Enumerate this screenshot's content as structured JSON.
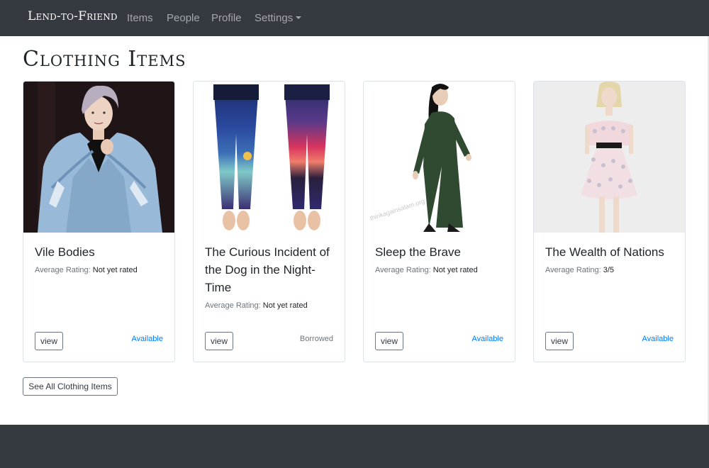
{
  "nav": {
    "brand": "Lend-to-Friend",
    "items": [
      "Items",
      "People",
      "Profile",
      "Settings"
    ]
  },
  "page": {
    "title": "Clothing Items",
    "see_all_label": "See All Clothing Items"
  },
  "cards": [
    {
      "title": "Vile Bodies",
      "rating_label": "Average Rating:",
      "rating_value": "Not yet rated",
      "button_label": "view",
      "status": "Available",
      "image_icon": "person-denim-jacket-photo"
    },
    {
      "title": "The Curious Incident of the Dog in the Night-Time",
      "rating_label": "Average Rating:",
      "rating_value": "Not yet rated",
      "button_label": "view",
      "status": "Borrowed",
      "image_icon": "leggings-photo"
    },
    {
      "title": "Sleep the Brave",
      "rating_label": "Average Rating:",
      "rating_value": "Not yet rated",
      "button_label": "view",
      "status": "Available",
      "image_icon": "green-dress-photo",
      "watermark": "thinkagainsalam.org"
    },
    {
      "title": "The Wealth of Nations",
      "rating_label": "Average Rating:",
      "rating_value": "3/5",
      "button_label": "view",
      "status": "Available",
      "image_icon": "lace-dress-photo"
    }
  ],
  "colors": {
    "navbar": "#343a40",
    "available": "#007bff",
    "borrowed": "#6c757d"
  }
}
